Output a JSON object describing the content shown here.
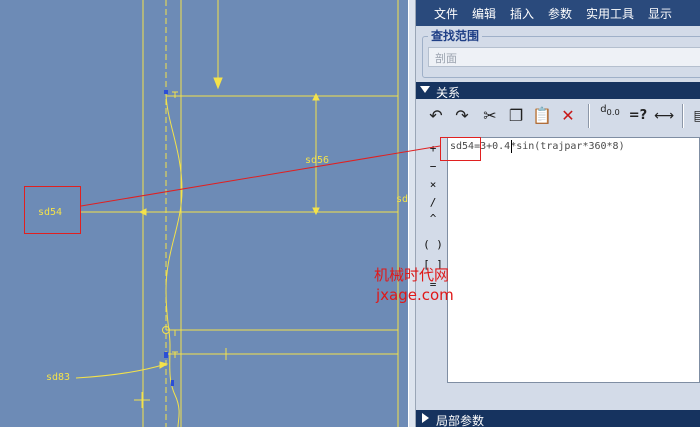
{
  "menu": {
    "file": "文件",
    "edit": "编辑",
    "insert": "插入",
    "params": "参数",
    "tools": "实用工具",
    "display": "显示"
  },
  "search": {
    "title": "查找范围",
    "value": "剖面"
  },
  "relations": {
    "title": "关系",
    "equation": "sd54=3+0.4*sin(trajpar*360*8)"
  },
  "toolbar": {
    "undo_icon": "undo-icon",
    "redo_icon": "redo-icon",
    "cut_icon": "scissors-icon",
    "copy_icon": "copy-icon",
    "paste_icon": "paste-icon",
    "delete_icon": "delete-x-icon",
    "eval_label": "=?"
  },
  "operators": [
    "+",
    "−",
    "×",
    "/",
    "^",
    "( )",
    "[ ]",
    "="
  ],
  "local_params": {
    "title": "局部参数"
  },
  "sketch_labels": {
    "sd54": "sd54",
    "sd56": "sd56",
    "sd83": "sd83",
    "sd_partial": "sd"
  },
  "watermark": {
    "cn": "机械时代网",
    "en": "jxage.com"
  },
  "colors": {
    "sketch_yellow": "#f4e24a",
    "canvas_blue": "#6d8bb6",
    "menu_blue": "#2a4a7c",
    "header_navy": "#16335f",
    "highlight_red": "#e02020"
  }
}
